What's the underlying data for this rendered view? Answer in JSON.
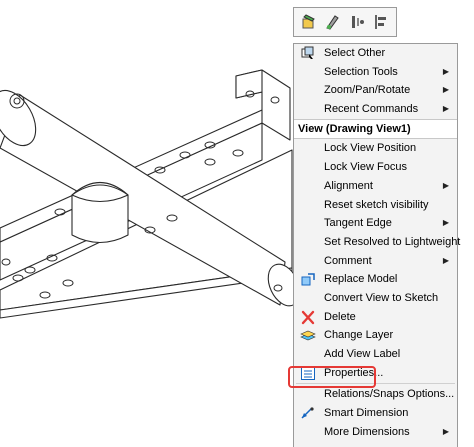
{
  "toolbar": {
    "buttons": [
      {
        "icon": "select-paint-icon"
      },
      {
        "icon": "smart-select-icon"
      },
      {
        "icon": "rebuild-icon"
      },
      {
        "icon": "align-icon"
      }
    ]
  },
  "menu": {
    "items": [
      {
        "label": "Select Other",
        "icon": "select-other-icon",
        "submenu": false
      },
      {
        "label": "Selection Tools",
        "submenu": true
      },
      {
        "label": "Zoom/Pan/Rotate",
        "submenu": true
      },
      {
        "label": "Recent Commands",
        "submenu": true
      }
    ],
    "header": "View (Drawing View1)",
    "view_items": [
      {
        "label": "Lock View Position",
        "submenu": false
      },
      {
        "label": "Lock View Focus",
        "submenu": false
      },
      {
        "label": "Alignment",
        "submenu": true
      },
      {
        "label": "Reset sketch visibility",
        "submenu": false
      },
      {
        "label": "Tangent Edge",
        "submenu": true
      },
      {
        "label": "Set Resolved to Lightweight",
        "submenu": false
      },
      {
        "label": "Comment",
        "submenu": true
      },
      {
        "label": "Replace Model",
        "icon": "replace-model-icon",
        "submenu": false
      },
      {
        "label": "Convert View to Sketch",
        "submenu": false
      },
      {
        "label": "Delete",
        "icon": "delete-icon",
        "submenu": false
      },
      {
        "label": "Change Layer",
        "icon": "layer-icon",
        "submenu": false
      },
      {
        "label": "Add View Label",
        "submenu": false
      },
      {
        "label": "Properties...",
        "icon": "properties-icon",
        "submenu": false
      },
      {
        "label": "Relations/Snaps Options...",
        "submenu": false
      },
      {
        "label": "Smart Dimension",
        "icon": "smart-dimension-icon",
        "submenu": false
      },
      {
        "label": "More Dimensions",
        "submenu": true
      }
    ]
  },
  "colors": {
    "highlight": "#e53935",
    "delete": "#e53935",
    "menu_bg": "#f3f3f3",
    "drawing_line": "#2a2a2a"
  }
}
